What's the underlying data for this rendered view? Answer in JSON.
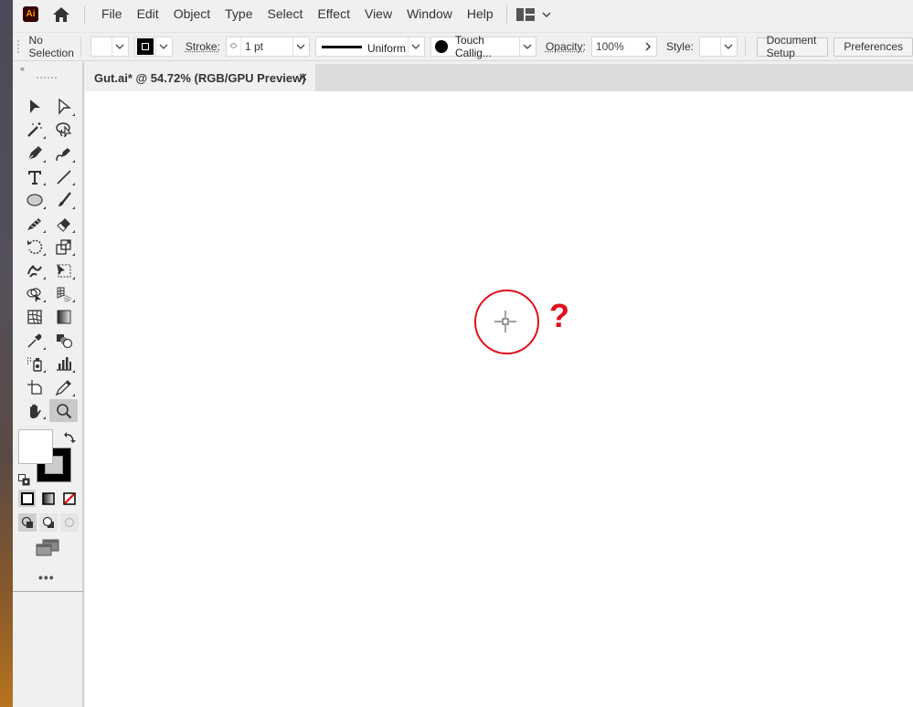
{
  "app": {
    "logo_text": "Ai",
    "brand_color": "#ff9a00"
  },
  "menubar": {
    "items": [
      "File",
      "Edit",
      "Object",
      "Type",
      "Select",
      "Effect",
      "View",
      "Window",
      "Help"
    ]
  },
  "controlbar": {
    "selection_status": "No Selection",
    "stroke_label": "Stroke:",
    "stroke_weight": "1 pt",
    "profile_label": "Uniform",
    "brush_label": "Touch Callig...",
    "opacity_label": "Opacity:",
    "opacity_value": "100%",
    "style_label": "Style:",
    "document_setup_label": "Document Setup",
    "preferences_label": "Preferences"
  },
  "document": {
    "tab_title": "Gut.ai* @ 54.72% (RGB/GPU Preview)",
    "close_glyph": "✕"
  },
  "toolbar": {
    "collapse_glyph": "«",
    "more_glyph": "•••",
    "tools": [
      {
        "name": "selection-tool"
      },
      {
        "name": "direct-selection-tool"
      },
      {
        "name": "magic-wand-tool"
      },
      {
        "name": "lasso-tool"
      },
      {
        "name": "pen-tool"
      },
      {
        "name": "curvature-tool"
      },
      {
        "name": "type-tool"
      },
      {
        "name": "line-segment-tool"
      },
      {
        "name": "ellipse-tool"
      },
      {
        "name": "paintbrush-tool"
      },
      {
        "name": "pencil-tool"
      },
      {
        "name": "eraser-tool"
      },
      {
        "name": "rotate-tool"
      },
      {
        "name": "scale-tool"
      },
      {
        "name": "puppet-warp-tool"
      },
      {
        "name": "free-transform-tool"
      },
      {
        "name": "shape-builder-tool"
      },
      {
        "name": "perspective-grid-tool"
      },
      {
        "name": "mesh-tool"
      },
      {
        "name": "gradient-tool"
      },
      {
        "name": "eyedropper-tool"
      },
      {
        "name": "blend-tool"
      },
      {
        "name": "symbol-sprayer-tool"
      },
      {
        "name": "column-graph-tool"
      },
      {
        "name": "artboard-tool"
      },
      {
        "name": "slice-tool"
      },
      {
        "name": "hand-tool"
      },
      {
        "name": "zoom-tool"
      }
    ],
    "active_tool": "zoom-tool",
    "fill_color": "#ffffff",
    "stroke_color": "#000000"
  },
  "annotation": {
    "mark_text": "?",
    "color": "#e0101a"
  }
}
